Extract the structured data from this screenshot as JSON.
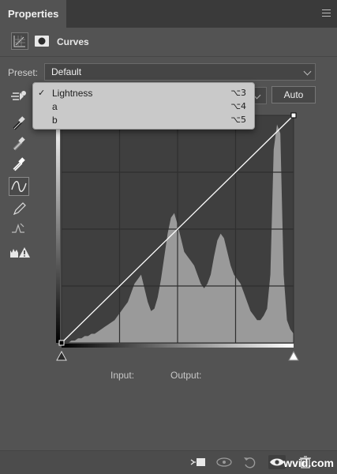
{
  "panel": {
    "tab_title": "Properties",
    "adjustment_title": "Curves"
  },
  "preset": {
    "label": "Preset:",
    "value": "Default"
  },
  "channel_dropdown": {
    "items": [
      {
        "label": "Lightness",
        "shortcut": "⌥3",
        "checked": true
      },
      {
        "label": "a",
        "shortcut": "⌥4",
        "checked": false
      },
      {
        "label": "b",
        "shortcut": "⌥5",
        "checked": false
      }
    ]
  },
  "auto_label": "Auto",
  "readout": {
    "input_label": "Input:",
    "output_label": "Output:"
  },
  "watermark": "wvid.com",
  "curve_points": [
    [
      0,
      0
    ],
    [
      100,
      100
    ]
  ],
  "histogram": [
    0,
    0,
    0,
    1,
    1,
    2,
    2,
    3,
    3,
    4,
    4,
    5,
    6,
    7,
    8,
    9,
    10,
    12,
    14,
    16,
    18,
    22,
    26,
    28,
    30,
    24,
    18,
    14,
    15,
    20,
    28,
    38,
    48,
    55,
    57,
    52,
    46,
    40,
    38,
    36,
    34,
    30,
    26,
    24,
    26,
    30,
    38,
    45,
    48,
    46,
    40,
    34,
    30,
    28,
    26,
    22,
    18,
    14,
    12,
    10,
    10,
    12,
    15,
    30,
    85,
    96,
    92,
    30,
    10,
    6,
    4
  ],
  "colors": {
    "panel_bg": "#535353",
    "graph_bg": "#3f3f3f",
    "histogram": "#9a9a9a",
    "dropdown_bg": "#c9c9c9"
  }
}
